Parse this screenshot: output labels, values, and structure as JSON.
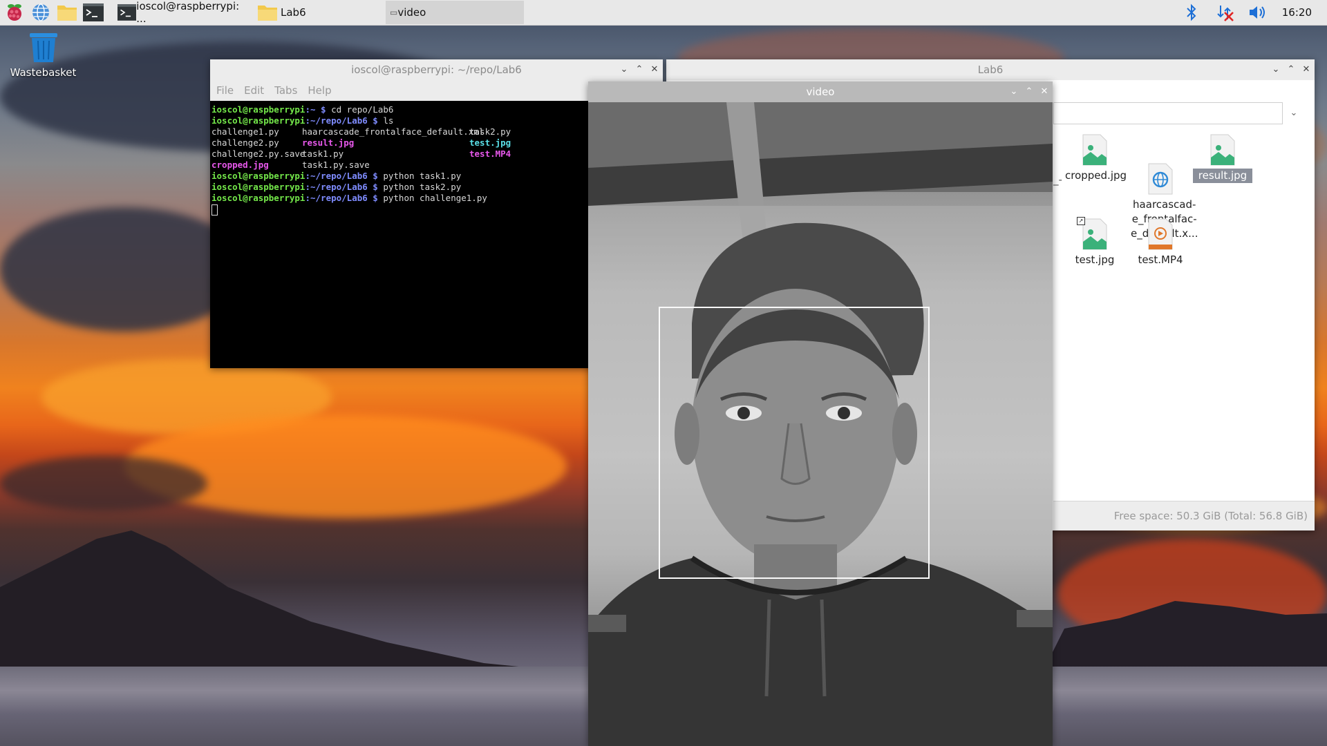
{
  "taskbar": {
    "tasks": [
      {
        "label": "ioscol@raspberrypi: ..."
      },
      {
        "label": "Lab6"
      },
      {
        "label": "video"
      }
    ],
    "clock": "16:20"
  },
  "desktop": {
    "wastebasket_label": "Wastebasket"
  },
  "terminal": {
    "title": "ioscol@raspberrypi: ~/repo/Lab6",
    "menu": [
      "File",
      "Edit",
      "Tabs",
      "Help"
    ],
    "prompt_user": "ioscol@raspberrypi",
    "lines": {
      "l1_path": ":~ $ ",
      "l1_cmd": "cd repo/Lab6",
      "l2_path": ":~/repo/Lab6 $ ",
      "l2_cmd": "ls",
      "ls_col1": [
        "challenge1.py",
        "challenge2.py",
        "challenge2.py.save",
        "cropped.jpg"
      ],
      "ls_col2": [
        "haarcascade_frontalface_default.xml",
        "result.jpg",
        "task1.py",
        "task1.py.save"
      ],
      "ls_col3": [
        "task2.py",
        "test.jpg",
        "test.MP4"
      ],
      "cmd_a": "python task1.py",
      "cmd_b": "python task2.py",
      "cmd_c": "python challenge1.py"
    }
  },
  "filemanager": {
    "title": "Lab6",
    "truncated_item": "_-",
    "files": [
      {
        "name": "cropped.jpg"
      },
      {
        "name": "haarcascad-\ne_frontalfac-\ne_default.x..."
      },
      {
        "name": "result.jpg"
      },
      {
        "name": "test.jpg"
      },
      {
        "name": "test.MP4"
      }
    ],
    "status": "Free space: 50.3 GiB (Total: 56.8 GiB)"
  },
  "video": {
    "title": "video"
  }
}
